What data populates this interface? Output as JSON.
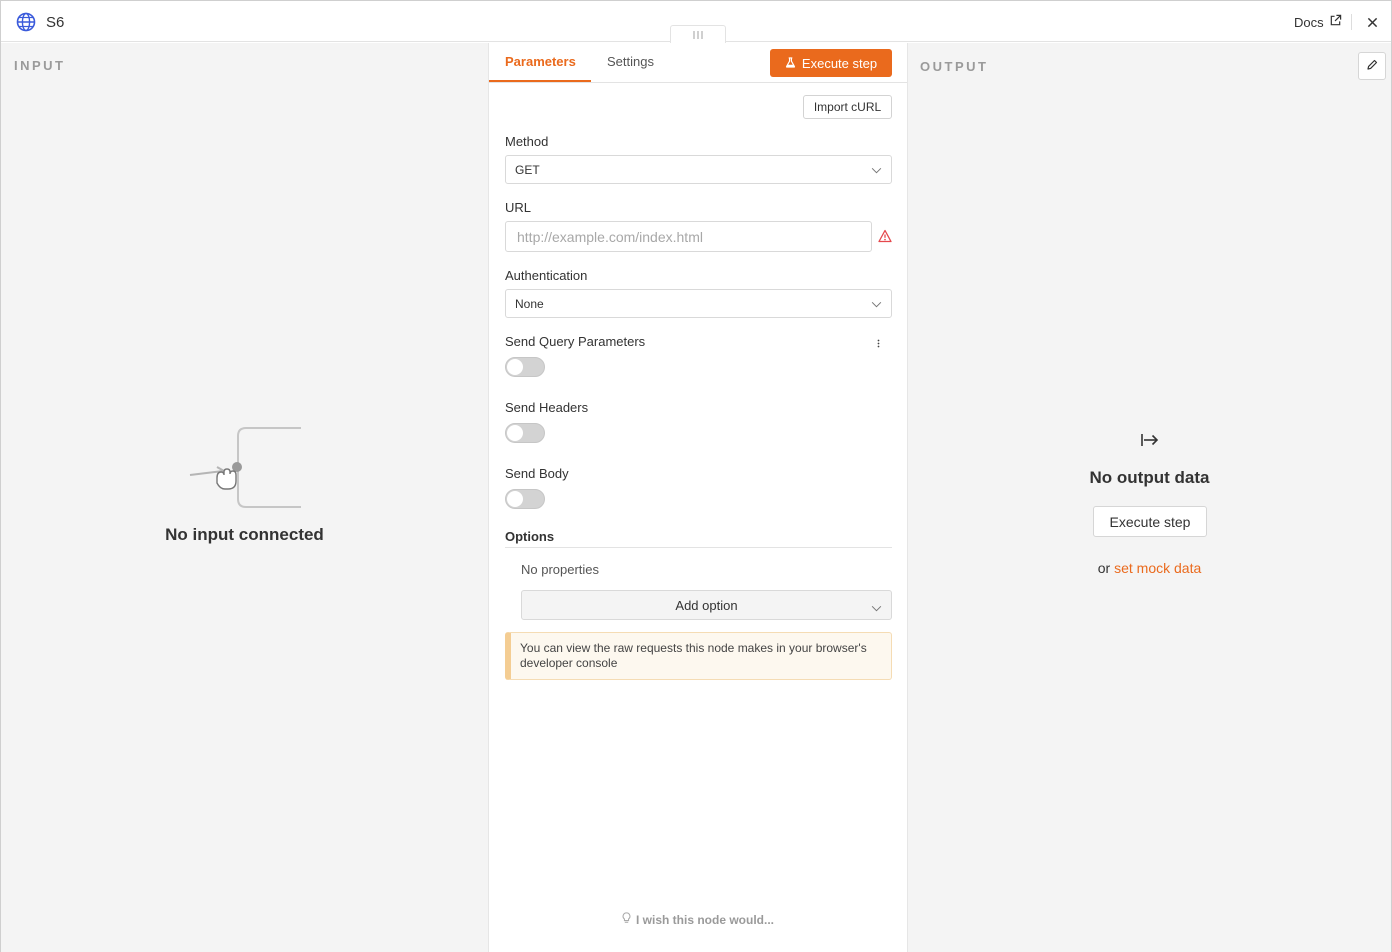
{
  "header": {
    "title": "S6",
    "docs_label": "Docs"
  },
  "input_panel": {
    "heading": "INPUT",
    "empty_text": "No input connected"
  },
  "tabs": [
    {
      "label": "Parameters",
      "active": true
    },
    {
      "label": "Settings",
      "active": false
    }
  ],
  "toolbar": {
    "execute_label": "Execute step",
    "import_label": "Import cURL"
  },
  "form": {
    "method": {
      "label": "Method",
      "value": "GET"
    },
    "url": {
      "label": "URL",
      "placeholder": "http://example.com/index.html",
      "value": ""
    },
    "authentication": {
      "label": "Authentication",
      "value": "None"
    },
    "send_query": {
      "label": "Send Query Parameters",
      "enabled": false
    },
    "send_headers": {
      "label": "Send Headers",
      "enabled": false
    },
    "send_body": {
      "label": "Send Body",
      "enabled": false
    },
    "options": {
      "label": "Options",
      "empty_text": "No properties",
      "add_label": "Add option"
    },
    "notice": "You can view the raw requests this node makes in your browser's developer console"
  },
  "footer": {
    "wish_text": "I wish this node would..."
  },
  "output_panel": {
    "heading": "OUTPUT",
    "empty_text": "No output data",
    "execute_label": "Execute step",
    "or_text": "or",
    "mock_link": "set mock data"
  },
  "colors": {
    "accent": "#ea6a1d",
    "panel_bg": "#f4f4f4",
    "warning": "#e5484d"
  },
  "icons": [
    "globe-icon",
    "external-link-icon",
    "close-icon",
    "drag-handle-icon",
    "flask-icon",
    "chevron-down-icon",
    "warning-icon",
    "kebab-menu-icon",
    "lightbulb-icon",
    "pencil-icon",
    "arrow-right-to-line-icon"
  ]
}
